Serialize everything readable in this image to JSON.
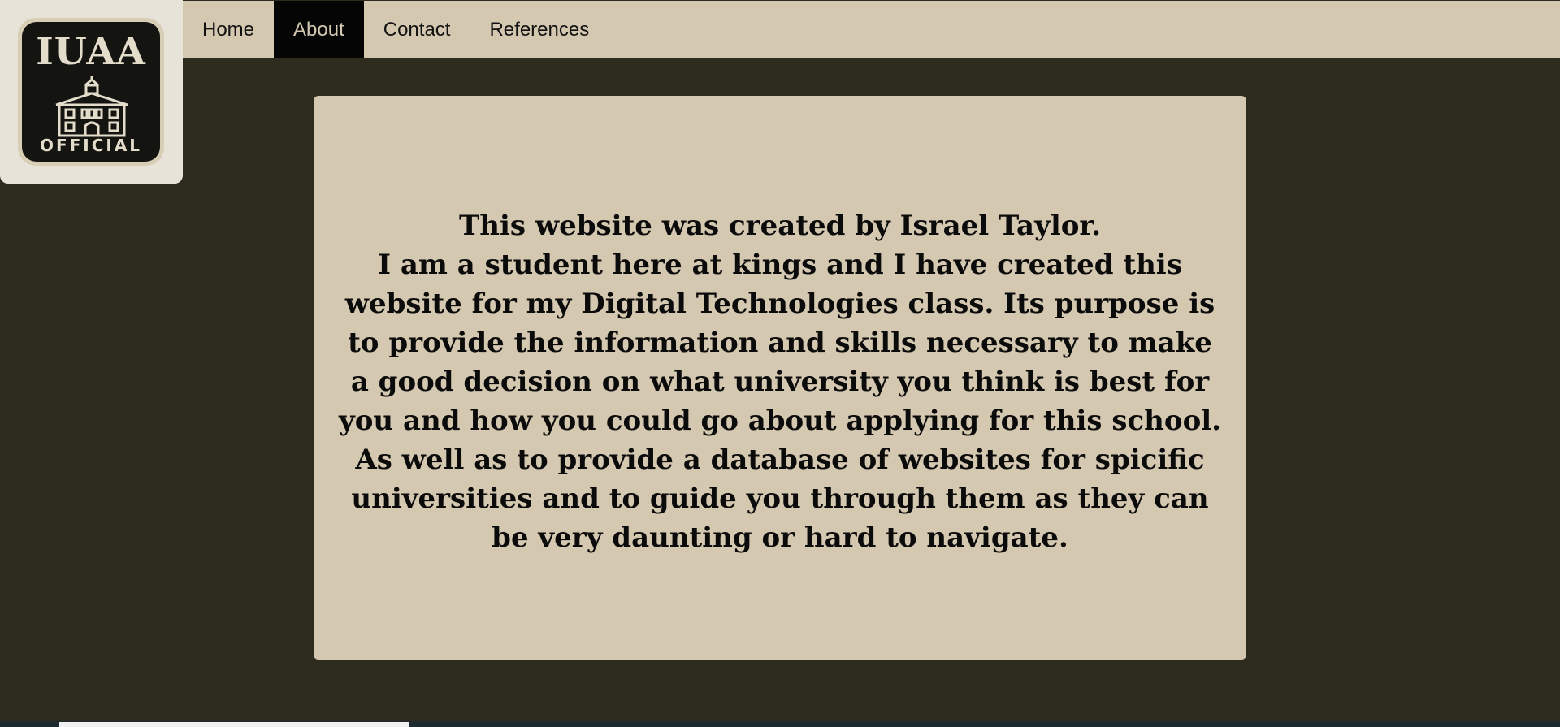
{
  "logo": {
    "title": "IUAA",
    "subtitle": "OFFICIAL",
    "icon": "school-building-icon"
  },
  "nav": {
    "items": [
      {
        "label": "Home",
        "active": false
      },
      {
        "label": "About",
        "active": true
      },
      {
        "label": "Contact",
        "active": false
      },
      {
        "label": "References",
        "active": false
      }
    ]
  },
  "content": {
    "heading": "This website was created by Israel Taylor.",
    "body": "I am a student here at kings and I have created this website for my Digital Technologies class. Its purpose is to provide the information and skills necessary to make a good decision on what university you think is best for you and how you could go about applying for this school. As well as to provide a database of websites for spicific universities and to guide you through them as they can be very daunting or hard to navigate."
  },
  "colors": {
    "background": "#2e2b1f",
    "panel": "#d4c8b0",
    "nav_active": "#050505",
    "text": "#0b0b0b"
  }
}
